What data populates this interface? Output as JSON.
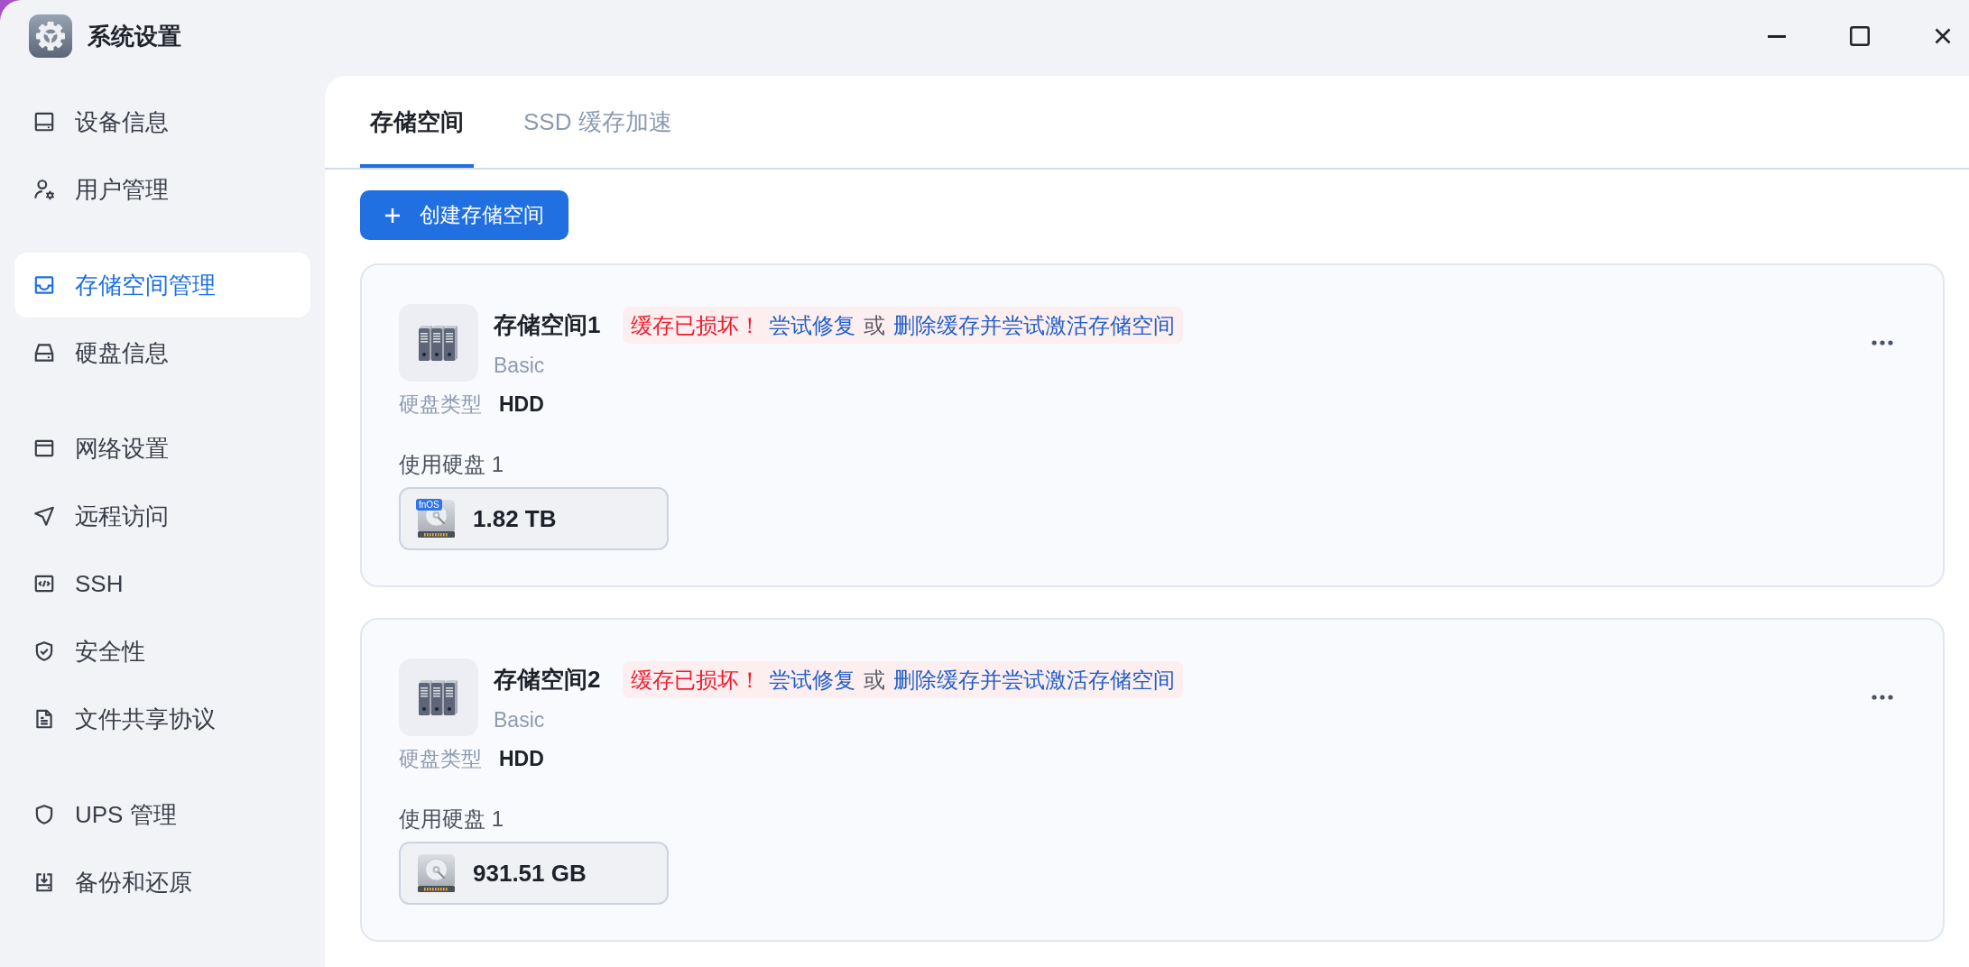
{
  "window": {
    "title": "系统设置"
  },
  "sidebar": {
    "groups": [
      {
        "items": [
          {
            "label": "设备信息",
            "selected": false
          },
          {
            "label": "用户管理",
            "selected": false
          }
        ]
      },
      {
        "items": [
          {
            "label": "存储空间管理",
            "selected": true
          },
          {
            "label": "硬盘信息",
            "selected": false
          }
        ]
      },
      {
        "items": [
          {
            "label": "网络设置",
            "selected": false
          },
          {
            "label": "远程访问",
            "selected": false
          },
          {
            "label": "SSH",
            "selected": false
          },
          {
            "label": "安全性",
            "selected": false
          },
          {
            "label": "文件共享协议",
            "selected": false
          }
        ]
      },
      {
        "items": [
          {
            "label": "UPS 管理",
            "selected": false
          },
          {
            "label": "备份和还原",
            "selected": false
          }
        ]
      }
    ]
  },
  "tabs": [
    {
      "label": "存储空间",
      "selected": true
    },
    {
      "label": "SSD 缓存加速",
      "selected": false
    }
  ],
  "create_button": {
    "label": "创建存储空间"
  },
  "storage_pools": [
    {
      "name": "存储空间1",
      "error": {
        "message": "缓存已损坏！",
        "actions": [
          {
            "label": "尝试修复"
          },
          {
            "label": "删除缓存并尝试激活存储空间"
          }
        ],
        "separator": "或"
      },
      "type": "Basic",
      "disk_type_label": "硬盘类型",
      "disk_type": "HDD",
      "disks_label": "使用硬盘 1",
      "disks": [
        {
          "capacity": "1.82 TB",
          "badge": "fnOS"
        }
      ]
    },
    {
      "name": "存储空间2",
      "error": {
        "message": "缓存已损坏！",
        "actions": [
          {
            "label": "尝试修复"
          },
          {
            "label": "删除缓存并尝试激活存储空间"
          }
        ],
        "separator": "或"
      },
      "type": "Basic",
      "disk_type_label": "硬盘类型",
      "disk_type": "HDD",
      "disks_label": "使用硬盘 1",
      "disks": [
        {
          "capacity": "931.51 GB"
        }
      ]
    }
  ]
}
